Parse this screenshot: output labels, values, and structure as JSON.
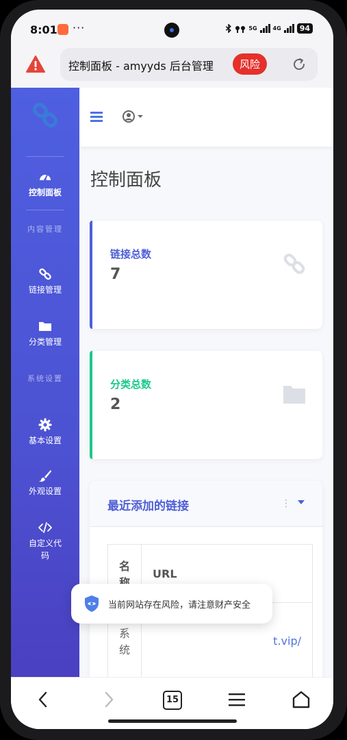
{
  "status_bar": {
    "time": "8:01",
    "more": "···",
    "network_5g": "5G",
    "network_4g": "4G",
    "battery": "94"
  },
  "address_bar": {
    "page_title": "控制面板 - amyyds 后台管理",
    "risk_badge": "风险"
  },
  "sidebar": {
    "items": [
      {
        "label": "控制面板",
        "icon": "dashboard-icon",
        "active": true
      },
      {
        "heading": "内容管理"
      },
      {
        "label": "链接管理",
        "icon": "link-icon"
      },
      {
        "label": "分类管理",
        "icon": "folder-icon"
      },
      {
        "heading": "系统设置"
      },
      {
        "label": "基本设置",
        "icon": "gear-icon"
      },
      {
        "label": "外观设置",
        "icon": "brush-icon"
      },
      {
        "label": "自定义代码",
        "icon": "code-icon"
      }
    ]
  },
  "main": {
    "title": "控制面板",
    "stats": [
      {
        "label": "链接总数",
        "value": "7",
        "color": "#4e5fd6",
        "icon": "link-icon"
      },
      {
        "label": "分类总数",
        "value": "2",
        "color": "#1cc88a",
        "icon": "folder-icon"
      }
    ],
    "recent": {
      "title": "最近添加的链接",
      "columns": [
        "名称",
        "URL"
      ],
      "rows": [
        {
          "name": "系统",
          "url": "t.vip/"
        }
      ]
    }
  },
  "toast": {
    "message": "当前网站存在风险，请注意财产安全"
  },
  "bottom_nav": {
    "tab_count": "15"
  },
  "colors": {
    "sidebar": "#4e5fe0",
    "primary": "#4e5fd6",
    "success": "#1cc88a",
    "danger": "#e5302b"
  }
}
